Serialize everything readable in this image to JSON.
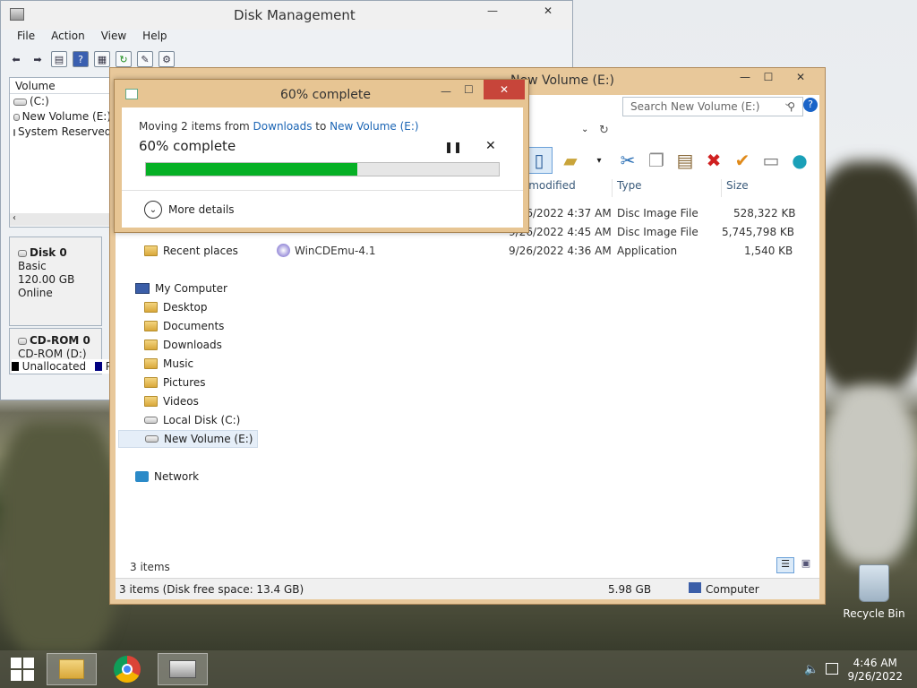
{
  "disk_mgmt": {
    "title": "Disk Management",
    "menus": [
      "File",
      "Action",
      "View",
      "Help"
    ],
    "volume_header": "Volume",
    "volumes": [
      "(C:)",
      "New Volume (E:)",
      "System Reserved"
    ],
    "disk0": {
      "name": "Disk 0",
      "type": "Basic",
      "size": "120.00 GB",
      "status": "Online"
    },
    "cdrom": {
      "name": "CD-ROM 0",
      "label": "CD-ROM (D:)"
    },
    "legend": {
      "unallocated": "Unallocated",
      "primary_partial": "P"
    }
  },
  "explorer": {
    "title": "New Volume (E:)",
    "search_placeholder": "Search New Volume (E:)",
    "columns": [
      "Date modified",
      "Type",
      "Size"
    ],
    "column_shown_partial": "e modified",
    "files": [
      {
        "name": "",
        "date": "9/26/2022 4:37 AM",
        "type": "Disc Image File",
        "size": "528,322 KB"
      },
      {
        "name": "",
        "date": "9/26/2022 4:45 AM",
        "type": "Disc Image File",
        "size": "5,745,798 KB"
      },
      {
        "name": "WinCDEmu-4.1",
        "date": "9/26/2022 4:36 AM",
        "type": "Application",
        "size": "1,540 KB"
      }
    ],
    "nav": {
      "recent_places": "Recent places",
      "my_computer": "My Computer",
      "folders": [
        "Desktop",
        "Documents",
        "Downloads",
        "Music",
        "Pictures",
        "Videos",
        "Local Disk (C:)",
        "New Volume (E:)"
      ],
      "network": "Network"
    },
    "item_count": "3 items",
    "status_left": "3 items (Disk free space: 13.4 GB)",
    "status_size": "5.98 GB",
    "status_location": "Computer"
  },
  "copy_dialog": {
    "title": "60% complete",
    "moving_prefix": "Moving 2 items from ",
    "source": "Downloads",
    "to_word": " to ",
    "dest": "New Volume (E:)",
    "progress_text": "60% complete",
    "progress_fraction": 0.6,
    "more_details": "More details"
  },
  "desktop": {
    "recycle_bin": "Recycle Bin"
  },
  "taskbar": {
    "time": "4:46 AM",
    "date": "9/26/2022"
  }
}
